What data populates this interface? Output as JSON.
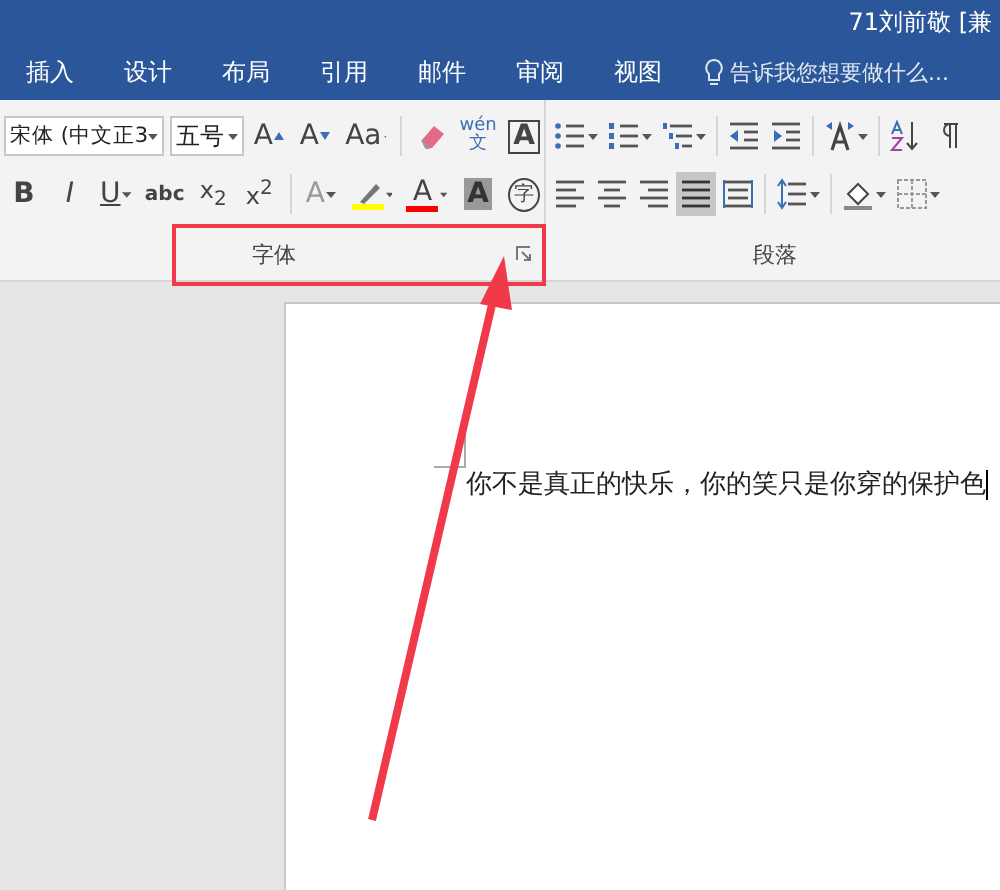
{
  "window": {
    "title": "71刘前敬 [兼"
  },
  "tabs": [
    {
      "label": "插入",
      "selected": false
    },
    {
      "label": "设计",
      "selected": false
    },
    {
      "label": "布局",
      "selected": false
    },
    {
      "label": "引用",
      "selected": false
    },
    {
      "label": "邮件",
      "selected": false
    },
    {
      "label": "审阅",
      "selected": false
    },
    {
      "label": "视图",
      "selected": false
    }
  ],
  "tell_me": {
    "placeholder": "告诉我您想要做什么..."
  },
  "font_group": {
    "font_name": "宋体 (中文正3",
    "font_size": "五号",
    "label": "字体",
    "row_1": [
      {
        "kind": "grow",
        "text": "A",
        "dropdown": false
      },
      {
        "kind": "shrink",
        "text": "A",
        "dropdown": false
      },
      {
        "kind": "case",
        "text": "Aa",
        "dropdown": true
      },
      {
        "kind": "clear",
        "dropdown": false
      },
      {
        "kind": "phonetic",
        "text": "wén",
        "text2": "文",
        "dropdown": false
      },
      {
        "kind": "border",
        "text": "A",
        "dropdown": false
      }
    ],
    "row_2": [
      {
        "kind": "bold",
        "text": "B",
        "dropdown": false
      },
      {
        "kind": "italic",
        "text": "I",
        "dropdown": false
      },
      {
        "kind": "underline",
        "text": "U",
        "dropdown": true
      },
      {
        "kind": "strike",
        "text": "abc",
        "dropdown": false
      },
      {
        "kind": "subscript",
        "text": "x$_{2}$",
        "dropdown": false
      },
      {
        "kind": "superscript",
        "text": "x$^{2}$",
        "dropdown": false
      },
      {
        "kind": "effect",
        "text": "A",
        "dropdown": true,
        "disabled": true
      },
      {
        "kind": "highlight",
        "dropdown": true
      },
      {
        "kind": "color",
        "text": "A",
        "dropdown": true
      },
      {
        "kind": "shading",
        "text": "A",
        "dropdown": false
      },
      {
        "kind": "enclose",
        "text": "字",
        "dropdown": false
      }
    ]
  },
  "paragraph_group": {
    "label": "段落",
    "row_1": [
      {
        "kind": "bullets",
        "dropdown": true,
        "selected": false
      },
      {
        "kind": "numbering",
        "dropdown": true,
        "selected": false
      },
      {
        "kind": "multilevel",
        "dropdown": true,
        "selected": false
      },
      {
        "kind": "outdent",
        "dropdown": false,
        "selected": false
      },
      {
        "kind": "indent",
        "dropdown": false,
        "selected": false
      },
      {
        "kind": "asian",
        "dropdown": true,
        "selected": false
      },
      {
        "kind": "sort",
        "dropdown": false,
        "selected": false
      },
      {
        "kind": "marks",
        "dropdown": false,
        "selected": false
      }
    ],
    "row_2": [
      {
        "kind": "left",
        "dropdown": false,
        "selected": false
      },
      {
        "kind": "center",
        "dropdown": false,
        "selected": false
      },
      {
        "kind": "right",
        "dropdown": false,
        "selected": false
      },
      {
        "kind": "justify",
        "dropdown": false,
        "selected": true
      },
      {
        "kind": "distributed",
        "dropdown": false,
        "selected": false
      },
      {
        "kind": "spacing",
        "dropdown": true,
        "selected": false
      },
      {
        "kind": "fill",
        "dropdown": true,
        "selected": false
      },
      {
        "kind": "borders",
        "dropdown": true,
        "selected": false
      }
    ]
  },
  "document": {
    "text": "你不是真正的快乐，你的笑只是你穿的保护色"
  }
}
